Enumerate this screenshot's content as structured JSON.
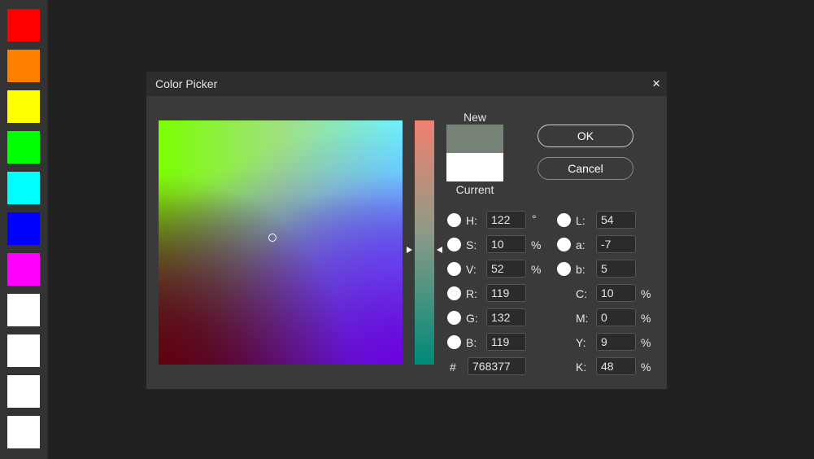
{
  "palette": [
    {
      "name": "red",
      "color": "#ff0000"
    },
    {
      "name": "orange",
      "color": "#ff7f00"
    },
    {
      "name": "yellow",
      "color": "#ffff00"
    },
    {
      "name": "green",
      "color": "#00ff00"
    },
    {
      "name": "cyan",
      "color": "#00ffff"
    },
    {
      "name": "blue",
      "color": "#0000ff"
    },
    {
      "name": "magenta",
      "color": "#ff00ff"
    },
    {
      "name": "white-1",
      "color": "#ffffff"
    },
    {
      "name": "white-2",
      "color": "#ffffff"
    },
    {
      "name": "white-3",
      "color": "#ffffff"
    },
    {
      "name": "white-4",
      "color": "#ffffff"
    }
  ],
  "dialog": {
    "title": "Color Picker",
    "close_icon": "×",
    "new_label": "New",
    "current_label": "Current",
    "new_color": "#778377",
    "current_color": "#ffffff",
    "ok_label": "OK",
    "cancel_label": "Cancel"
  },
  "fields": {
    "h": {
      "label": "H:",
      "value": "122",
      "unit": "°"
    },
    "s": {
      "label": "S:",
      "value": "10",
      "unit": "%"
    },
    "v": {
      "label": "V:",
      "value": "52",
      "unit": "%"
    },
    "r": {
      "label": "R:",
      "value": "119"
    },
    "g": {
      "label": "G:",
      "value": "132"
    },
    "b": {
      "label": "B:",
      "value": "119"
    },
    "hex": {
      "label": "#",
      "value": "768377"
    },
    "L": {
      "label": "L:",
      "value": "54"
    },
    "a": {
      "label": "a:",
      "value": "-7"
    },
    "lab_b": {
      "label": "b:",
      "value": "5"
    },
    "c": {
      "label": "C:",
      "value": "10",
      "unit": "%"
    },
    "m": {
      "label": "M:",
      "value": "0",
      "unit": "%"
    },
    "y": {
      "label": "Y:",
      "value": "9",
      "unit": "%"
    },
    "k": {
      "label": "K:",
      "value": "48",
      "unit": "%"
    }
  }
}
